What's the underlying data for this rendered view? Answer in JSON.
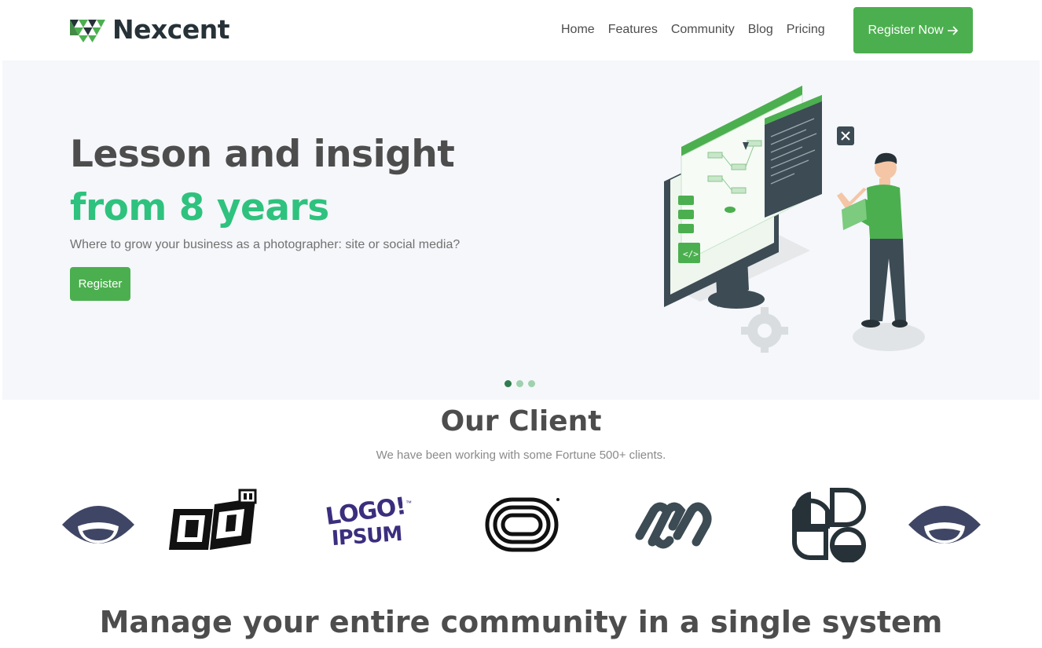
{
  "brand": {
    "name": "Nexcent",
    "accent_color": "#4caf4f",
    "logo_icon": "nexcent-logo-icon"
  },
  "nav": {
    "items": [
      "Home",
      "Features",
      "Community",
      "Blog",
      "Pricing"
    ],
    "cta_label": "Register Now",
    "cta_icon": "arrow-right-icon"
  },
  "hero": {
    "title": "Lesson and insight",
    "title_accent": "from 8 years",
    "subtitle": "Where to grow your business as a photographer: site or social media?",
    "button_label": "Register",
    "accent_color": "#2ec27e",
    "illustration": "developer-illustration",
    "slides_total": 3,
    "active_slide": 1
  },
  "clients": {
    "title": "Our Client",
    "subtitle": "We have been working with some Fortune 500+ clients.",
    "logo_text": {
      "logo_ipsum": "LOGO!",
      "logo_ipsum_2": "IPSUM",
      "trademark": "™"
    }
  },
  "manage": {
    "title": "Manage your entire community in a single system"
  }
}
